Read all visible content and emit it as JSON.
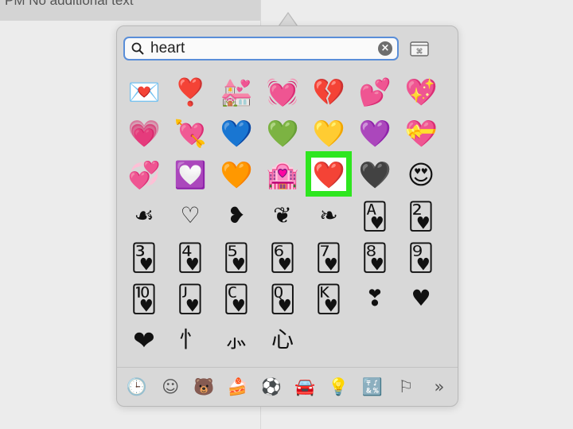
{
  "background": {
    "top_left_text": "PM   No additional text"
  },
  "search": {
    "value": "heart"
  },
  "emoji_rows": [
    [
      "💌",
      "❣️",
      "💒",
      "💓",
      "💔",
      "💕",
      "💖"
    ],
    [
      "💗",
      "💘",
      "💙",
      "💚",
      "💛",
      "💜",
      "💝"
    ],
    [
      "💞",
      "💟",
      "🧡",
      "🏩",
      "❤️",
      "🖤",
      "😍"
    ],
    [
      "☙",
      "♡",
      "❥",
      "❦",
      "❧",
      "🂱",
      "🂲"
    ],
    [
      "🂳",
      "🂴",
      "🂵",
      "🂶",
      "🂷",
      "🂸",
      "🂹"
    ],
    [
      "🂺",
      "🂻",
      "🂼",
      "🂽",
      "🂾",
      "❣",
      "♥"
    ],
    [
      "❤",
      "忄",
      "⺗",
      "心",
      "",
      "",
      ""
    ]
  ],
  "selected": {
    "row": 2,
    "col": 4
  },
  "footer": {
    "icons": [
      {
        "name": "recent-icon",
        "glyph": "🕒"
      },
      {
        "name": "smileys-icon",
        "glyph": "☺"
      },
      {
        "name": "animals-icon",
        "glyph": "🐻"
      },
      {
        "name": "food-icon",
        "glyph": "🍰"
      },
      {
        "name": "activity-icon",
        "glyph": "⚽"
      },
      {
        "name": "travel-icon",
        "glyph": "🚘"
      },
      {
        "name": "objects-icon",
        "glyph": "💡"
      },
      {
        "name": "symbols-icon",
        "glyph": "🔣"
      },
      {
        "name": "flags-icon",
        "glyph": "⚐"
      },
      {
        "name": "more-icon",
        "glyph": "»"
      }
    ]
  },
  "colors": {
    "accent_border": "#5a8ed8",
    "selection": "#2ee61f"
  }
}
